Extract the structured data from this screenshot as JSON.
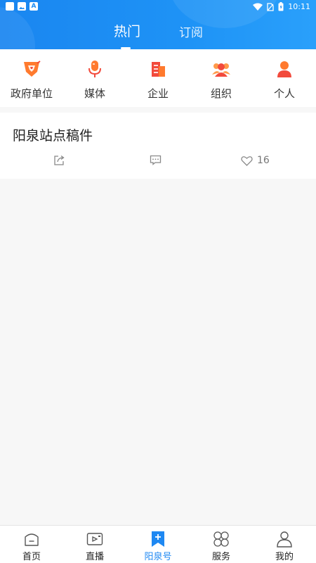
{
  "status_bar": {
    "time": "10:11"
  },
  "header": {
    "tabs": [
      {
        "label": "热门",
        "active": true
      },
      {
        "label": "订阅",
        "active": false
      }
    ]
  },
  "categories": [
    {
      "label": "政府单位",
      "icon": "government-shield-icon"
    },
    {
      "label": "媒体",
      "icon": "microphone-icon"
    },
    {
      "label": "企业",
      "icon": "building-icon"
    },
    {
      "label": "组织",
      "icon": "group-icon"
    },
    {
      "label": "个人",
      "icon": "person-icon"
    }
  ],
  "article": {
    "title": "阳泉站点稿件",
    "likes": "16"
  },
  "bottom_nav": [
    {
      "label": "首页",
      "icon": "home-icon"
    },
    {
      "label": "直播",
      "icon": "live-camera-icon"
    },
    {
      "label": "阳泉号",
      "icon": "bookmark-plus-icon",
      "active": true
    },
    {
      "label": "服务",
      "icon": "grid-services-icon"
    },
    {
      "label": "我的",
      "icon": "profile-icon"
    }
  ],
  "colors": {
    "header_blue": "#1e8ef4",
    "accent_blue": "#1e88f2",
    "icon_orange": "#ff7a2e",
    "icon_red": "#f24a3c"
  }
}
